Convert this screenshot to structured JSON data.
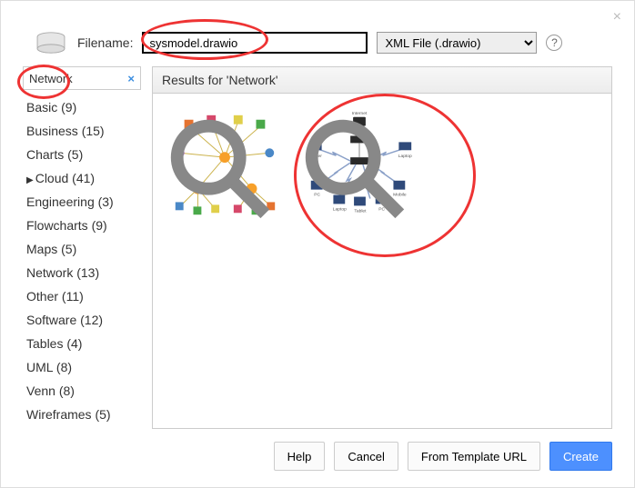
{
  "header": {
    "filename_label": "Filename:",
    "filename_value": "sysmodel.drawio",
    "filetype_label": "XML File (.drawio)",
    "help_tooltip": "?"
  },
  "sidebar": {
    "search_value": "Network",
    "categories": [
      {
        "label": "Basic (9)",
        "expandable": false
      },
      {
        "label": "Business (15)",
        "expandable": false
      },
      {
        "label": "Charts (5)",
        "expandable": false
      },
      {
        "label": "Cloud (41)",
        "expandable": true
      },
      {
        "label": "Engineering (3)",
        "expandable": false
      },
      {
        "label": "Flowcharts (9)",
        "expandable": false
      },
      {
        "label": "Maps (5)",
        "expandable": false
      },
      {
        "label": "Network (13)",
        "expandable": false
      },
      {
        "label": "Other (11)",
        "expandable": false
      },
      {
        "label": "Software (12)",
        "expandable": false
      },
      {
        "label": "Tables (4)",
        "expandable": false
      },
      {
        "label": "UML (8)",
        "expandable": false
      },
      {
        "label": "Venn (8)",
        "expandable": false
      },
      {
        "label": "Wireframes (5)",
        "expandable": false
      }
    ]
  },
  "results": {
    "header": "Results for 'Network'",
    "templates": [
      {
        "name": "network-cluster-template"
      },
      {
        "name": "network-star-template"
      }
    ]
  },
  "footer": {
    "help": "Help",
    "cancel": "Cancel",
    "from_url": "From Template URL",
    "create": "Create"
  }
}
